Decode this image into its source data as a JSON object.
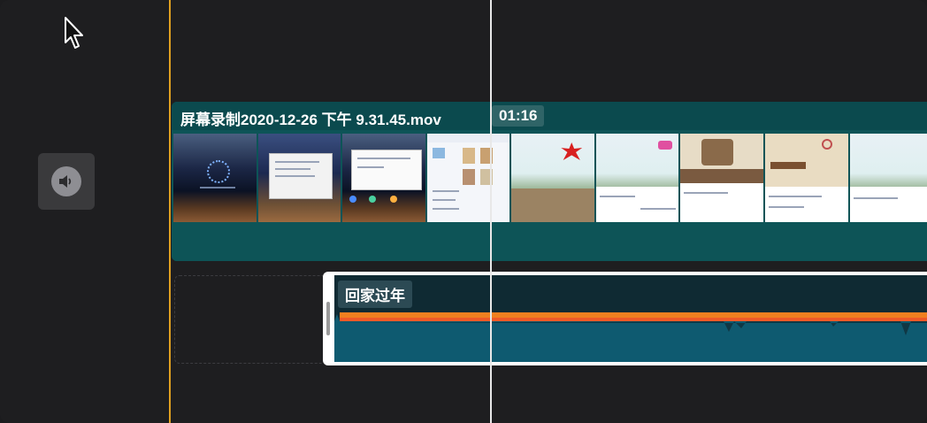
{
  "video_clip": {
    "title": "屏幕录制2020-12-26 下午 9.31.45.mov",
    "duration": "01:16",
    "thumbnail_count": 9
  },
  "audio_clip": {
    "title": "回家过年"
  },
  "icons": {
    "cursor": "mouse-pointer-icon",
    "volume": "speaker-icon"
  },
  "colors": {
    "start_marker": "#e0a020",
    "video_clip": "#0d5457",
    "audio_clip": "#0f2a33",
    "waveform_peak": "#f08020",
    "waveform_body": "#0e5a70",
    "playhead": "#e8e8e8"
  }
}
